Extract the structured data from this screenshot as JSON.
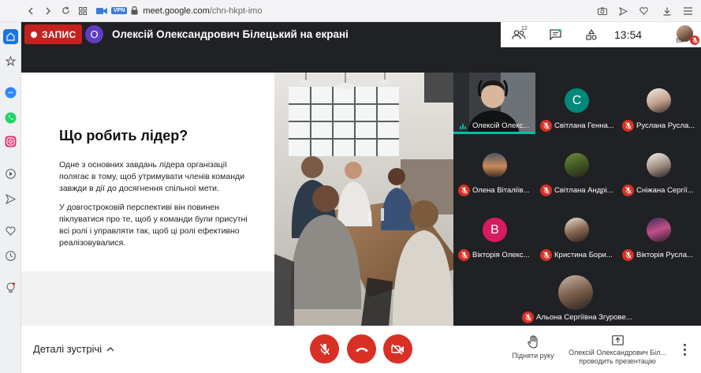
{
  "browser": {
    "url_domain": "meet.google.com",
    "url_path": "/chn-hkpt-imo",
    "vpn_label": "VPN"
  },
  "meeting": {
    "recording_label": "ЗАПИС",
    "presenter_initial": "О",
    "presenter_title": "Олексій Олександрович Білецький на екрані",
    "participant_count": "12",
    "time": "13:54",
    "self_label": "Ви"
  },
  "slide": {
    "heading": "Що робить лідер?",
    "paragraph1": "Одне з основних завдань лідера організації полягає в тому, щоб утримувати членів команди завжди в дії до досягнення спільної мети.",
    "paragraph2": "У довгостроковій перспективі він повинен піклуватися про те, щоб у команди були присутні всі ролі і управляти так, щоб ці ролі ефективно реалізовувалися."
  },
  "participants": [
    {
      "name": "Олексій Олекс...",
      "initial": "",
      "color": "",
      "muted": false
    },
    {
      "name": "Світлана Генна...",
      "initial": "С",
      "color": "#00897b",
      "muted": true
    },
    {
      "name": "Руслана Русла...",
      "initial": "",
      "color": "",
      "muted": true
    },
    {
      "name": "Олена Віталіїв...",
      "initial": "",
      "color": "",
      "muted": true
    },
    {
      "name": "Світлана Андрі...",
      "initial": "",
      "color": "",
      "muted": true
    },
    {
      "name": "Сніжана Сергії...",
      "initial": "",
      "color": "",
      "muted": true
    },
    {
      "name": "Вікторія Олекс...",
      "initial": "В",
      "color": "#d81b60",
      "muted": true
    },
    {
      "name": "Кристина Бори...",
      "initial": "",
      "color": "",
      "muted": true
    },
    {
      "name": "Вікторія Русла...",
      "initial": "",
      "color": "",
      "muted": true
    },
    {
      "name": "Альона Сергіївна Згурове...",
      "initial": "",
      "color": "",
      "muted": true
    }
  ],
  "bottom": {
    "meeting_details": "Деталі зустрічі",
    "raise_hand": "Підняти руку",
    "presenting_name": "Олексій Олександрович Біл...",
    "presenting_label": "проводить презентацію"
  },
  "colors": {
    "accent_red": "#d93025",
    "meet_dark": "#202124",
    "active_teal": "#00bfa5"
  }
}
